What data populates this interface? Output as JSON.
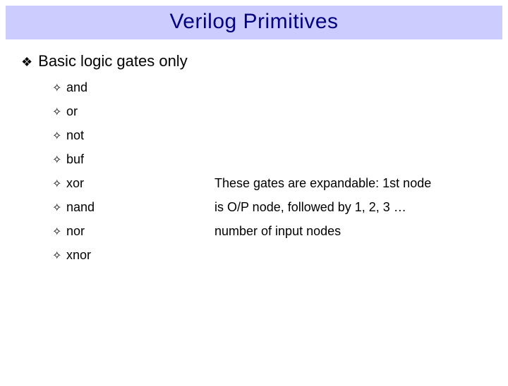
{
  "title": "Verilog Primitives",
  "heading": "Basic logic gates only",
  "bullets": {
    "diamond": "❖",
    "plus": "✧"
  },
  "gates": [
    {
      "name": "and",
      "desc": ""
    },
    {
      "name": "or",
      "desc": ""
    },
    {
      "name": "not",
      "desc": ""
    },
    {
      "name": "buf",
      "desc": ""
    },
    {
      "name": "xor",
      "desc": "These gates are expandable: 1st node"
    },
    {
      "name": "nand",
      "desc": "is O/P node, followed by 1, 2, 3 …"
    },
    {
      "name": "nor",
      "desc": "number of input nodes"
    },
    {
      "name": "xnor",
      "desc": ""
    }
  ]
}
